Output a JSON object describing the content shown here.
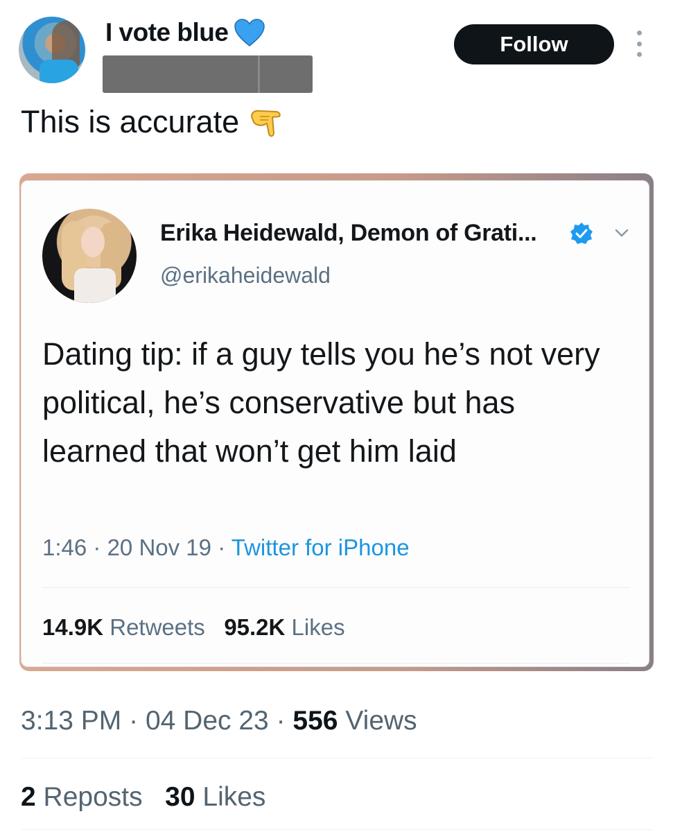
{
  "post": {
    "author": {
      "display_name": "I vote blue",
      "emoji_icon": "blue-heart-icon"
    },
    "follow_label": "Follow",
    "menu_icon": "more-vertical-icon",
    "text": "This is accurate",
    "text_emoji_icon": "backhand-index-pointing-down-icon",
    "time": "3:13 PM",
    "date": "04 Dec 23",
    "views_count": "556",
    "views_label": "Views",
    "reposts_count": "2",
    "reposts_label": "Reposts",
    "likes_count": "30",
    "likes_label": "Likes",
    "separator": "·"
  },
  "embedded_tweet": {
    "name": "Erika Heidewald, Demon of Grati...",
    "handle": "@erikaheidewald",
    "verified_icon": "verified-badge-icon",
    "text": "Dating tip: if a guy tells you he’s not very political, he’s conservative but has learned that won’t get him laid",
    "time": "1:46",
    "date": "20 Nov 19",
    "source": "Twitter for iPhone",
    "retweets_count": "14.9K",
    "retweets_label": "Retweets",
    "likes_count": "95.2K",
    "likes_label": "Likes",
    "separator": "·"
  },
  "colors": {
    "follow_bg": "#0f1419",
    "verified_blue": "#1d9bf0",
    "source_link": "#1b95e0",
    "muted_text": "#536471"
  }
}
